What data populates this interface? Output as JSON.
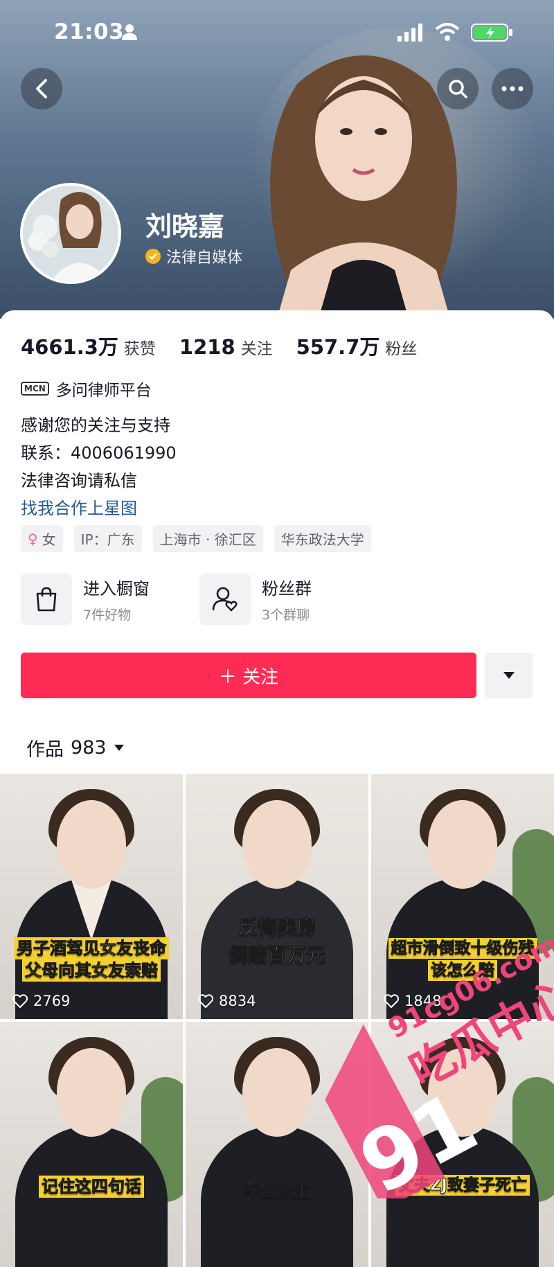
{
  "status_bar": {
    "time": "21:03"
  },
  "profile": {
    "name": "刘晓嘉",
    "verification": "法律自媒体"
  },
  "stats": [
    {
      "value": "4661.3万",
      "label": "获赞"
    },
    {
      "value": "1218",
      "label": "关注"
    },
    {
      "value": "557.7万",
      "label": "粉丝"
    }
  ],
  "mcn": {
    "badge": "MCN",
    "text": "多问律师平台"
  },
  "bio": {
    "line1": "感谢您的关注与支持",
    "line2": "联系：4006061990",
    "line3": "法律咨询请私信",
    "link": "找我合作上星图"
  },
  "tags": {
    "gender": "女",
    "ip": "IP：广东",
    "location": "上海市 · 徐汇区",
    "school": "华东政法大学"
  },
  "entries": [
    {
      "title": "进入橱窗",
      "subtitle": "7件好物"
    },
    {
      "title": "粉丝群",
      "subtitle": "3个群聊"
    }
  ],
  "follow_button": "＋ 关注",
  "works": {
    "label": "作品",
    "count": "983"
  },
  "videos": [
    {
      "caption1": "男子酒驾见女友丧命",
      "caption2": "父母向其女友索赔",
      "likes": "2769"
    },
    {
      "caption1": "反悔卖房",
      "caption2": "倒赔百万元",
      "likes": "8834"
    },
    {
      "caption1": "超市滑倒致十级伤残",
      "caption2": "该怎么赔",
      "likes": "1848"
    },
    {
      "caption1": "记住这四句话",
      "caption2": ""
    },
    {
      "caption1": "车位业主",
      "caption2": ""
    },
    {
      "caption1": "丈夫ZJ致妻子死亡",
      "caption2": ""
    }
  ],
  "watermark": {
    "brand": "91",
    "site": "91cg06.com",
    "name": "吃瓜中心"
  },
  "colors": {
    "follow": "#fe2c55",
    "link": "#235c8f",
    "verify": "#f5b324"
  }
}
